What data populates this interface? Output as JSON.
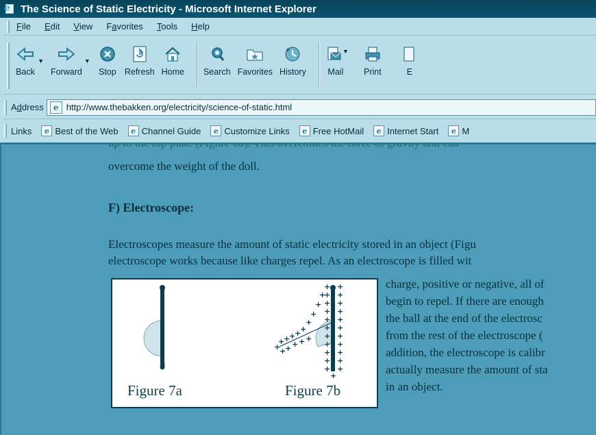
{
  "window": {
    "title": "The Science of Static Electricity - Microsoft Internet Explorer"
  },
  "menu": {
    "items": [
      {
        "label": "File",
        "key": "F"
      },
      {
        "label": "Edit",
        "key": "E"
      },
      {
        "label": "View",
        "key": "V"
      },
      {
        "label": "Favorites",
        "key": "a"
      },
      {
        "label": "Tools",
        "key": "T"
      },
      {
        "label": "Help",
        "key": "H"
      }
    ]
  },
  "toolbar": {
    "back": "Back",
    "forward": "Forward",
    "stop": "Stop",
    "refresh": "Refresh",
    "home": "Home",
    "search": "Search",
    "favorites": "Favorites",
    "history": "History",
    "mail": "Mail",
    "print": "Print"
  },
  "address": {
    "label": "Address",
    "url": "http://www.thebakken.org/electricity/science-of-static.html"
  },
  "links": {
    "label": "Links",
    "items": [
      "Best of the Web",
      "Channel Guide",
      "Customize Links",
      "Free HotMail",
      "Internet Start",
      "M"
    ]
  },
  "content": {
    "cut_line": "up to the top plate (Figure 6b). This overcomes the force of gravity and can",
    "line1": "overcome the weight of the doll.",
    "heading": "F) Electroscope:",
    "para1_line1": "Electroscopes measure the amount of static electricity stored in an object (Figu",
    "para1_line2": "electroscope works because like charges repel. As an electroscope is filled wit",
    "wrap_lines": [
      "charge, positive or negative, all of",
      "begin to repel. If there are enough",
      "the ball at the end of the electrosc",
      "from the rest of the electroscope (",
      "addition, the electroscope is calibr",
      "actually measure the amount of sta",
      "in an object."
    ],
    "figure_captions": [
      "Figure 7a",
      "Figure 7b"
    ]
  },
  "colors": {
    "background": "#1d6f8a",
    "chrome": "#b9dde9",
    "page": "#4d9dba",
    "text": "#08303c"
  }
}
